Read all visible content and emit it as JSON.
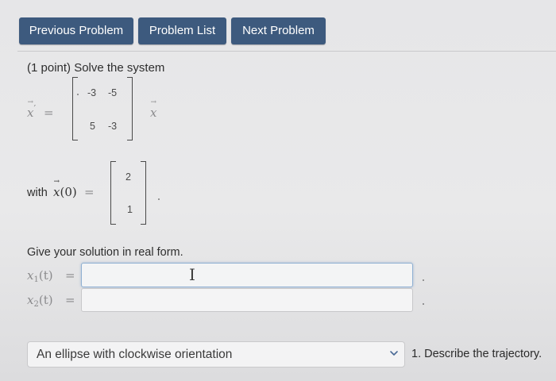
{
  "nav": {
    "previous_label": "Previous Problem",
    "list_label": "Problem List",
    "next_label": "Next Problem"
  },
  "problem": {
    "intro": "(1 point) Solve the system",
    "lhs_var": "x",
    "lhs_prime": "′",
    "equals": "=",
    "matrix": [
      "-3",
      "-5",
      "5",
      "-3"
    ],
    "rhs_var": "x",
    "with_label": "with",
    "initial_var": "x",
    "initial_arg": "(0)",
    "initial_vector": [
      "2",
      "1"
    ]
  },
  "solution": {
    "prompt": "Give your solution in real form.",
    "x1_label": "x",
    "x1_sub": "1",
    "x1_arg": "(t)",
    "x2_label": "x",
    "x2_sub": "2",
    "x2_arg": "(t)",
    "x1_value": "",
    "x2_value": ""
  },
  "trajectory": {
    "selected": "An ellipse with clockwise orientation",
    "question": "1. Describe the trajectory."
  },
  "icons": {
    "dropdown": "chevron-down-icon",
    "cursor": "text-cursor-icon"
  },
  "colors": {
    "nav_button": "#3d5a7e",
    "focus_border": "#8fb0d2"
  }
}
